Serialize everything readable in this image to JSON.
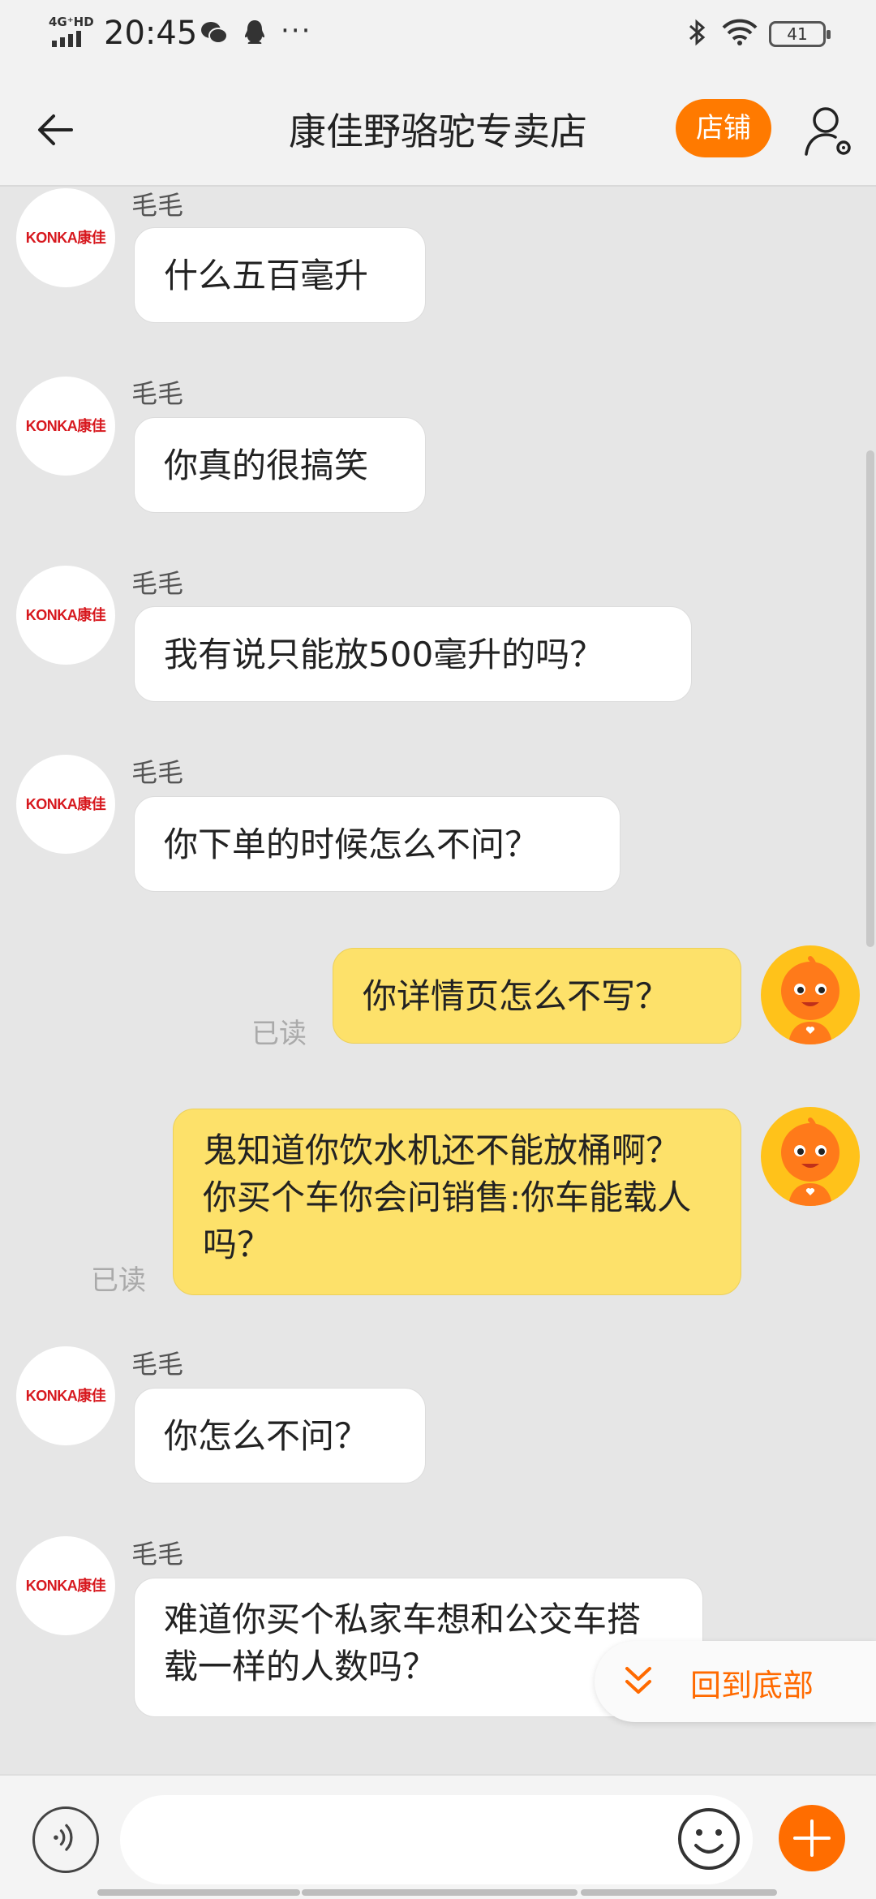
{
  "status_bar": {
    "network": "4G⁺HD",
    "time": "20:45",
    "battery": "41",
    "more": "···"
  },
  "header": {
    "title": "康佳野骆驼专卖店",
    "shop_button": "店铺"
  },
  "messages": [
    {
      "sender": "毛毛",
      "text": "什么五百毫升",
      "avatar": "KONKA康佳"
    },
    {
      "sender": "毛毛",
      "text": "你真的很搞笑",
      "avatar": "KONKA康佳"
    },
    {
      "sender": "毛毛",
      "text": "我有说只能放500毫升的吗？",
      "avatar": "KONKA康佳"
    },
    {
      "sender": "毛毛",
      "text": "你下单的时候怎么不问？",
      "avatar": "KONKA康佳"
    },
    {
      "text": "你详情页怎么不写？",
      "status": "已读"
    },
    {
      "text": "鬼知道你饮水机还不能放桶啊？你买个车你会问销售:你车能载人吗？",
      "status": "已读"
    },
    {
      "sender": "毛毛",
      "text": "你怎么不问？",
      "avatar": "KONKA康佳"
    },
    {
      "sender": "毛毛",
      "text": "难道你买个私家车想和公交车搭载一样的人数吗？",
      "avatar": "KONKA康佳"
    }
  ],
  "back_to_bottom": "回到底部",
  "input": {
    "placeholder": ""
  },
  "colors": {
    "accent": "#ff7a00",
    "my_bubble": "#fde16a",
    "background": "#e6e6e6"
  },
  "icons": [
    "back-arrow-icon",
    "profile-settings-icon",
    "voice-icon",
    "emoji-icon",
    "plus-icon",
    "double-chevron-down-icon"
  ]
}
